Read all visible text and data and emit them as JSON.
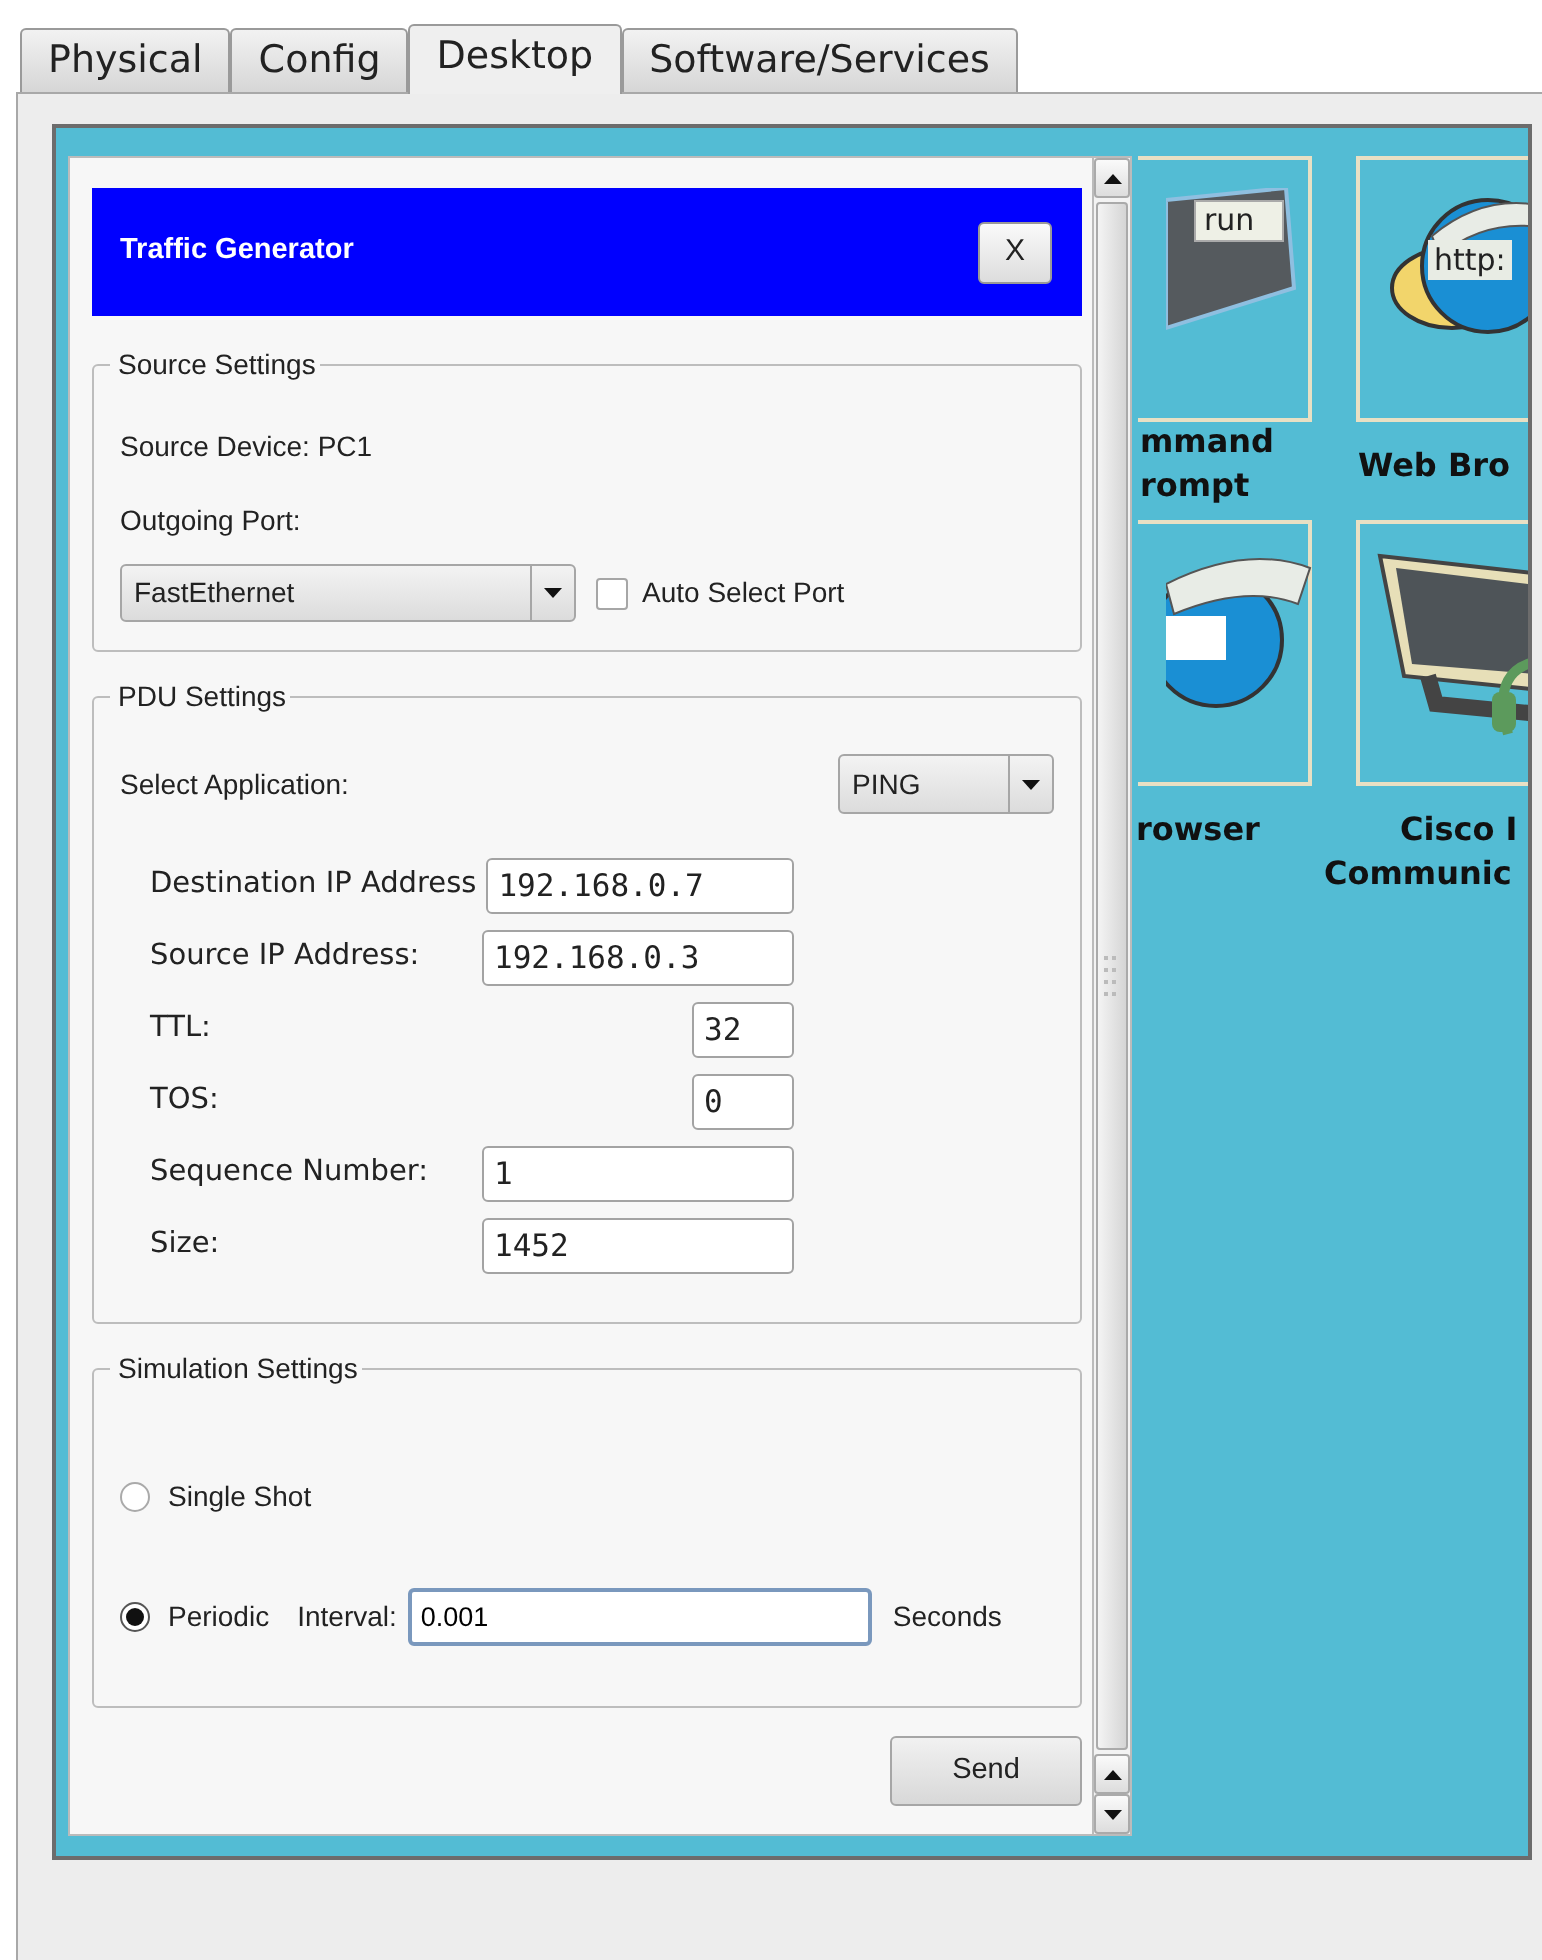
{
  "tabs": [
    {
      "label": "Physical",
      "selected": false
    },
    {
      "label": "Config",
      "selected": false
    },
    {
      "label": "Desktop",
      "selected": true
    },
    {
      "label": "Software/Services",
      "selected": false
    }
  ],
  "desktop_icons": [
    {
      "kind": "terminal",
      "icon_text": "run",
      "label_lines": [
        "mmand",
        "rompt"
      ]
    },
    {
      "kind": "browser",
      "icon_text": "http:",
      "label_lines": [
        "Web Bro"
      ]
    },
    {
      "kind": "mib",
      "label_lines": [
        "rowser"
      ]
    },
    {
      "kind": "phone",
      "label_lines": [
        "Cisco I",
        "Communic"
      ]
    }
  ],
  "dialog": {
    "title": "Traffic Generator",
    "close_label": "X",
    "source_settings": {
      "legend": "Source Settings",
      "device": "Source Device: PC1",
      "port_label": "Outgoing Port:",
      "port_value": "FastEthernet",
      "auto_select": {
        "label": "Auto Select Port",
        "checked": false
      }
    },
    "pdu_settings": {
      "legend": "PDU Settings",
      "app_label": "Select Application:",
      "app_value": "PING",
      "fields": [
        {
          "label": "Destination IP Address",
          "value": "192.168.0.7",
          "kind": "long"
        },
        {
          "label": "Source IP Address:",
          "value": "192.168.0.3",
          "kind": "long"
        },
        {
          "label": "TTL:",
          "value": "32",
          "kind": "short"
        },
        {
          "label": "TOS:",
          "value": "0",
          "kind": "short"
        },
        {
          "label": "Sequence Number:",
          "value": "1",
          "kind": "long"
        },
        {
          "label": "Size:",
          "value": "1452",
          "kind": "long"
        }
      ]
    },
    "simulation_settings": {
      "legend": "Simulation Settings",
      "modes": [
        {
          "label": "Single Shot",
          "selected": false
        },
        {
          "label": "Periodic",
          "selected": true,
          "interval": {
            "label": "Interval:",
            "value": "0.001",
            "unit": "Seconds"
          }
        }
      ]
    },
    "send_label": "Send"
  }
}
